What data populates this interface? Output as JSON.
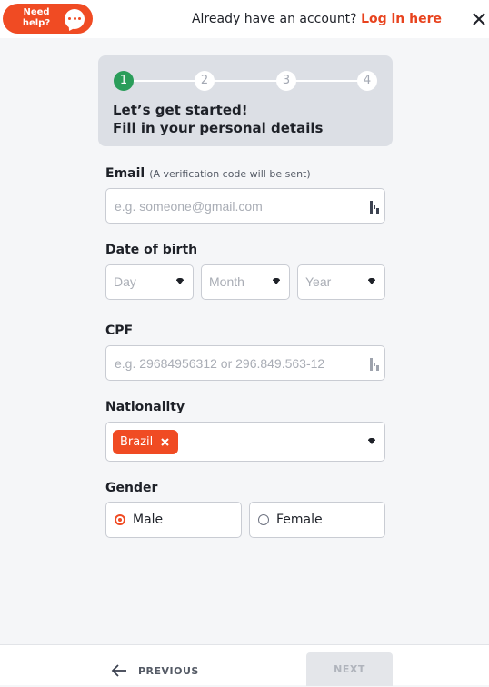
{
  "header": {
    "help_label_1": "Need",
    "help_label_2": "help?",
    "account_prompt": "Already have an account?",
    "login_link": "Log in here"
  },
  "stepper": {
    "steps": [
      "1",
      "2",
      "3",
      "4"
    ],
    "current_step": 1,
    "title": "Let’s get started!",
    "subtitle": "Fill in your personal details"
  },
  "form": {
    "email": {
      "label": "Email",
      "hint": "(A verification code will be sent)",
      "placeholder": "e.g. someone@gmail.com",
      "value": ""
    },
    "dob": {
      "label": "Date of birth",
      "day_placeholder": "Day",
      "month_placeholder": "Month",
      "year_placeholder": "Year"
    },
    "cpf": {
      "label": "CPF",
      "placeholder": "e.g. 29684956312 or 296.849.563-12",
      "value": ""
    },
    "nationality": {
      "label": "Nationality",
      "selected": [
        "Brazil"
      ]
    },
    "gender": {
      "label": "Gender",
      "options": [
        "Male",
        "Female"
      ],
      "selected": "Male"
    }
  },
  "footer": {
    "previous_label": "PREVIOUS",
    "next_label": "NEXT"
  },
  "colors": {
    "accent": "#f04b23",
    "link": "#e8431e",
    "step_active": "#2a9d5a",
    "stepper_bg": "#dcdfe5",
    "page_bg": "#f5f6f8",
    "border": "#c9ccd3",
    "disabled_button": "#e4e6ea"
  },
  "icons": {
    "help": "chat-bubble-icon",
    "close": "close-icon",
    "field_autofill": "autofill-key-icon",
    "select": "caret-down-icon",
    "tag_remove": "close-icon",
    "previous": "arrow-left-icon"
  }
}
